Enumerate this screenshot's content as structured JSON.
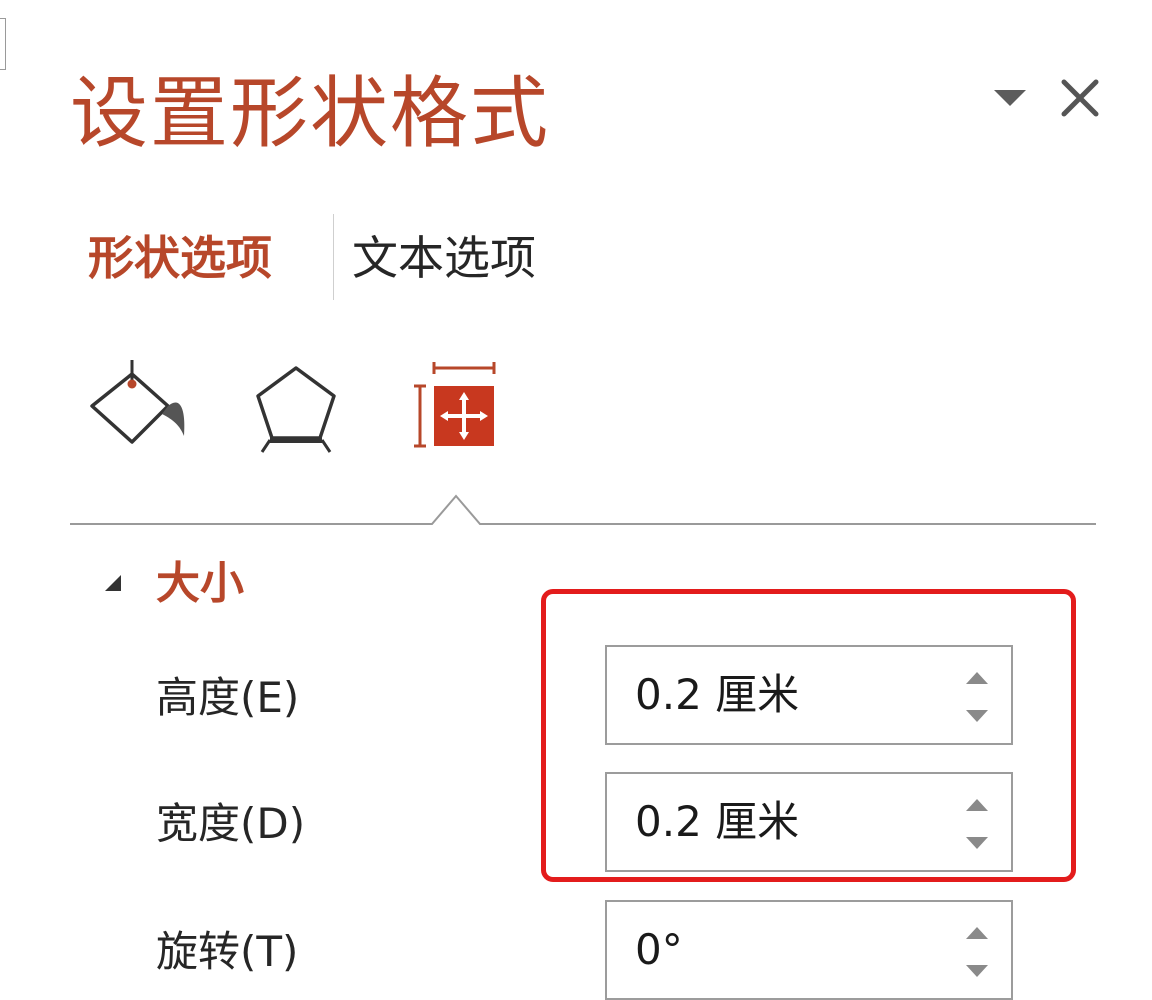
{
  "pane": {
    "title": "设置形状格式",
    "menu_icon": "triangle-down-icon",
    "close_icon": "close-icon"
  },
  "tabs": [
    {
      "label": "形状选项",
      "active": true
    },
    {
      "label": "文本选项",
      "active": false
    }
  ],
  "categories": [
    {
      "name": "fill-line",
      "icon": "paint-bucket-icon"
    },
    {
      "name": "effects",
      "icon": "pentagon-icon"
    },
    {
      "name": "size-properties",
      "icon": "size-properties-icon",
      "active": true
    }
  ],
  "section": {
    "title": "大小",
    "expanded": true
  },
  "fields": [
    {
      "label": "高度(E)",
      "value": "0.2 厘米"
    },
    {
      "label": "宽度(D)",
      "value": "0.2 厘米"
    },
    {
      "label": "旋转(T)",
      "value": "0°"
    }
  ],
  "colors": {
    "accent": "#b7472a",
    "highlight_box": "#e31c1c"
  }
}
